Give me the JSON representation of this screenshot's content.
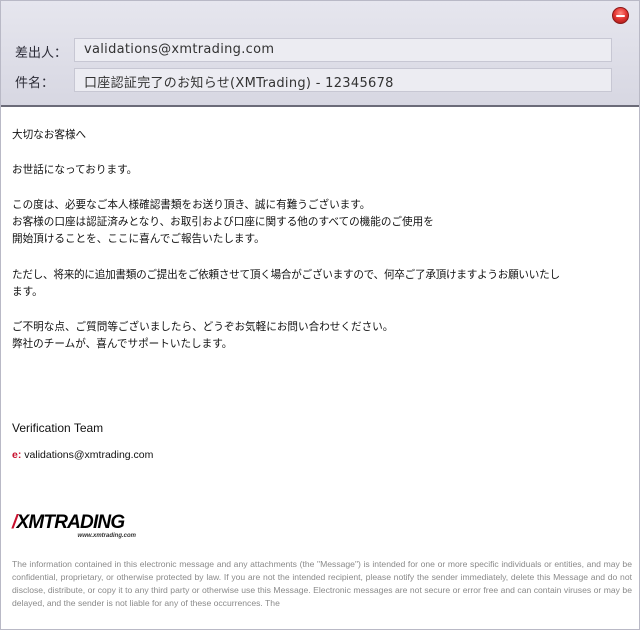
{
  "header": {
    "from_label": "差出人：",
    "from_value": "validations@xmtrading.com",
    "subject_label": "件名：",
    "subject_value": "口座認証完了のお知らせ(XMTrading) - 12345678"
  },
  "body": {
    "greeting": "大切なお客様へ",
    "intro": "お世話になっております。",
    "para1_line1": "この度は、必要なご本人様確認書類をお送り頂き、誠に有難うございます。",
    "para1_line2": "お客様の口座は認証済みとなり、お取引および口座に関する他のすべての機能のご使用を",
    "para1_line3": "開始頂けることを、ここに喜んでご報告いたします。",
    "para2_line1": "ただし、将来的に追加書類のご提出をご依頼させて頂く場合がございますので、何卒ご了承頂けますようお願いいたし",
    "para2_line2": "ます。",
    "para3_line1": "ご不明な点、ご質問等ございましたら、どうぞお気軽にお問い合わせください。",
    "para3_line2": "弊社のチームが、喜んでサポートいたします。"
  },
  "signature": {
    "team": "Verification Team",
    "email_prefix": "e:",
    "email": "validations@xmtrading.com"
  },
  "logo": {
    "slash": "/",
    "name": "XMTRADING",
    "url": "www.xmtrading.com"
  },
  "disclaimer": "The information contained in this electronic message and any attachments (the \"Message\") is intended for one or more specific individuals or entities, and may be confidential, proprietary, or otherwise protected by law. If you are not the intended recipient, please notify the sender immediately, delete this Message and do not disclose, distribute, or copy it to any third party or otherwise use this Message. Electronic messages are not secure or error free and can contain viruses or may be delayed, and the sender is not liable for any of these occurrences. The",
  "colors": {
    "header_bg": "#dcdce6",
    "field_bg": "#ececf2",
    "brand_red": "#c8102e",
    "disclaimer_text": "#8a8a8a"
  },
  "icons": {
    "close": "close-icon"
  }
}
